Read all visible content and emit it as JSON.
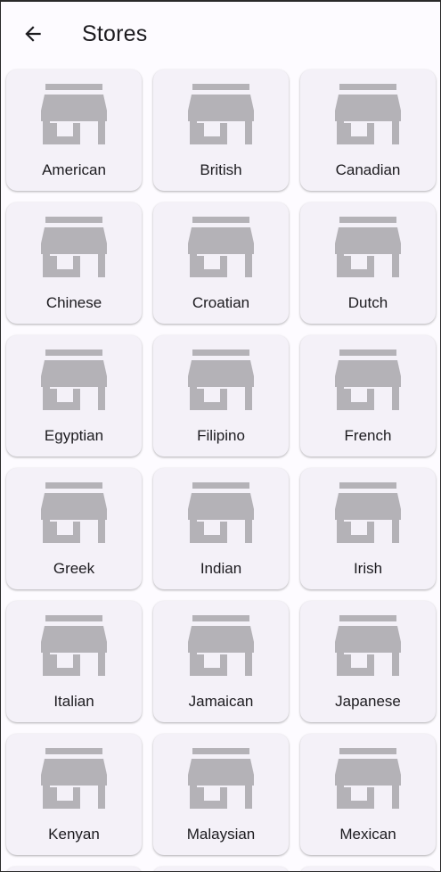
{
  "appbar": {
    "title": "Stores",
    "back_icon": "arrow-left-icon"
  },
  "store_icon": "storefront-icon",
  "colors": {
    "background": "#fdfbff",
    "card": "#f4f1f8",
    "icon": "#b4b2b7",
    "text": "#1c1b1f"
  },
  "stores": [
    {
      "label": "American"
    },
    {
      "label": "British"
    },
    {
      "label": "Canadian"
    },
    {
      "label": "Chinese"
    },
    {
      "label": "Croatian"
    },
    {
      "label": "Dutch"
    },
    {
      "label": "Egyptian"
    },
    {
      "label": "Filipino"
    },
    {
      "label": "French"
    },
    {
      "label": "Greek"
    },
    {
      "label": "Indian"
    },
    {
      "label": "Irish"
    },
    {
      "label": "Italian"
    },
    {
      "label": "Jamaican"
    },
    {
      "label": "Japanese"
    },
    {
      "label": "Kenyan"
    },
    {
      "label": "Malaysian"
    },
    {
      "label": "Mexican"
    }
  ]
}
